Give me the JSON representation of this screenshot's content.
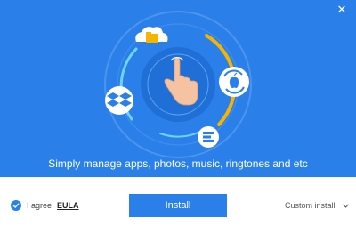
{
  "colors": {
    "accent": "#2a7fe8",
    "ring_progress": "#f5b400",
    "hand": "#f5c3a1"
  },
  "hero": {
    "tagline": "Simply manage apps, photos, music, ringtones and etc",
    "icons": [
      "cloud-folder-icon",
      "apple-sync-icon",
      "dropbox-icon",
      "evernote-icon",
      "touch-hand-icon"
    ]
  },
  "footer": {
    "agree_label": "I agree",
    "eula_link": "EULA",
    "install_button": "Install",
    "custom_install": "Custom install"
  },
  "window": {
    "close_glyph": "✕"
  }
}
